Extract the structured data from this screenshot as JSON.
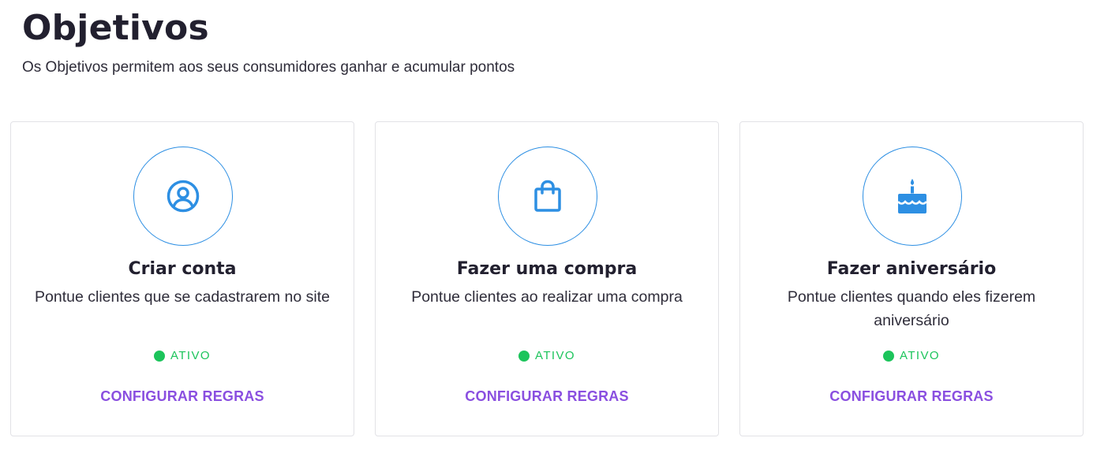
{
  "header": {
    "title": "Objetivos",
    "subtitle": "Os Objetivos permitem aos seus consumidores ganhar e acumular pontos"
  },
  "colors": {
    "accent_blue": "#2d8fe3",
    "status_green": "#1cc45b",
    "link_purple": "#8a4fe0"
  },
  "cards": [
    {
      "icon": "user-circle-icon",
      "title": "Criar conta",
      "description": "Pontue clientes que se cadastrarem no site",
      "status": "ATIVO",
      "action": "CONFIGURAR REGRAS"
    },
    {
      "icon": "shopping-bag-icon",
      "title": "Fazer uma compra",
      "description": "Pontue clientes ao realizar uma compra",
      "status": "ATIVO",
      "action": "CONFIGURAR REGRAS"
    },
    {
      "icon": "birthday-cake-icon",
      "title": "Fazer aniversário",
      "description": "Pontue clientes quando eles fizerem aniversário",
      "status": "ATIVO",
      "action": "CONFIGURAR REGRAS"
    }
  ]
}
